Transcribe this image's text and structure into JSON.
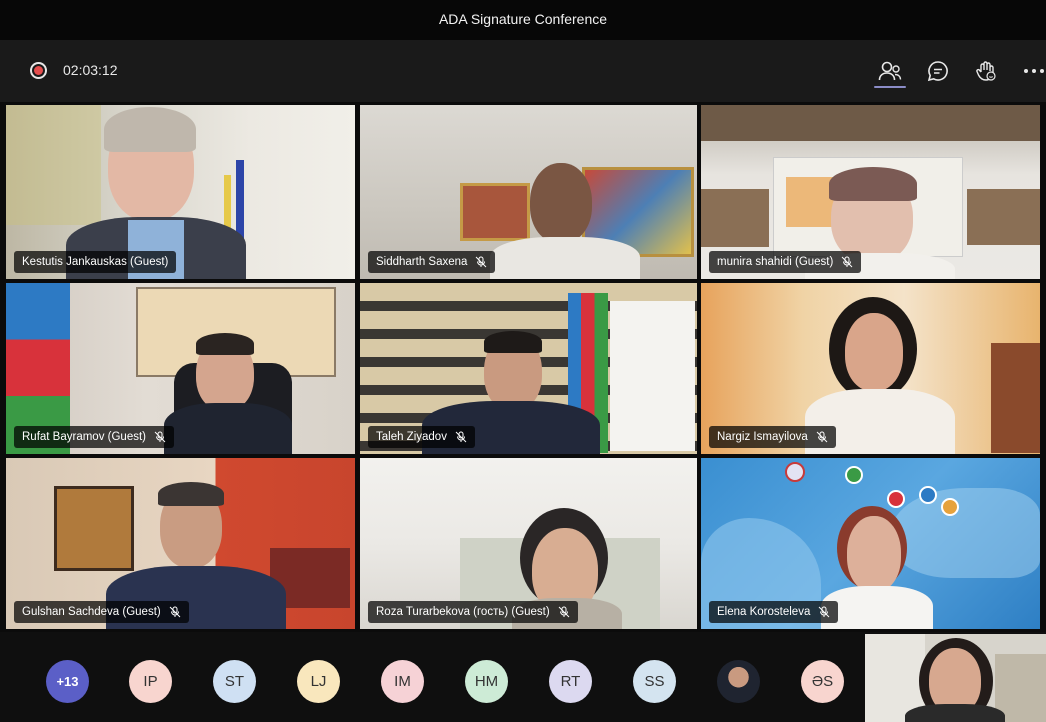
{
  "window": {
    "title": "ADA Signature Conference"
  },
  "toolbar": {
    "timer": "02:03:12",
    "icons": [
      "record-icon",
      "people-icon",
      "chat-icon",
      "react-icon",
      "more-icon"
    ]
  },
  "participants": [
    {
      "name": "Kestutis Jankauskas (Guest)",
      "muted": false
    },
    {
      "name": "Siddharth Saxena",
      "muted": true
    },
    {
      "name": "munira shahidi (Guest)",
      "muted": true
    },
    {
      "name": "Rufat Bayramov (Guest)",
      "muted": true
    },
    {
      "name": "Taleh Ziyadov",
      "muted": true
    },
    {
      "name": "Nargiz Ismayilova",
      "muted": true
    },
    {
      "name": "Gulshan Sachdeva (Guest)",
      "muted": true
    },
    {
      "name": "Roza Turarbekova (гость) (Guest)",
      "muted": true
    },
    {
      "name": "Elena Korosteleva",
      "muted": true
    }
  ],
  "roster": [
    {
      "label": "+13",
      "color": "#5b5fc7"
    },
    {
      "label": "IP",
      "color": "#f8d5cf"
    },
    {
      "label": "ST",
      "color": "#cfe0f3"
    },
    {
      "label": "LJ",
      "color": "#f9e7bd"
    },
    {
      "label": "IM",
      "color": "#f6d2d6"
    },
    {
      "label": "HM",
      "color": "#cdebd6"
    },
    {
      "label": "RT",
      "color": "#dcd9f0"
    },
    {
      "label": "SS",
      "color": "#d4e4f0"
    },
    {
      "label": "",
      "color": "#8a8a8a"
    },
    {
      "label": "ƏS",
      "color": "#f8d5cf"
    }
  ]
}
